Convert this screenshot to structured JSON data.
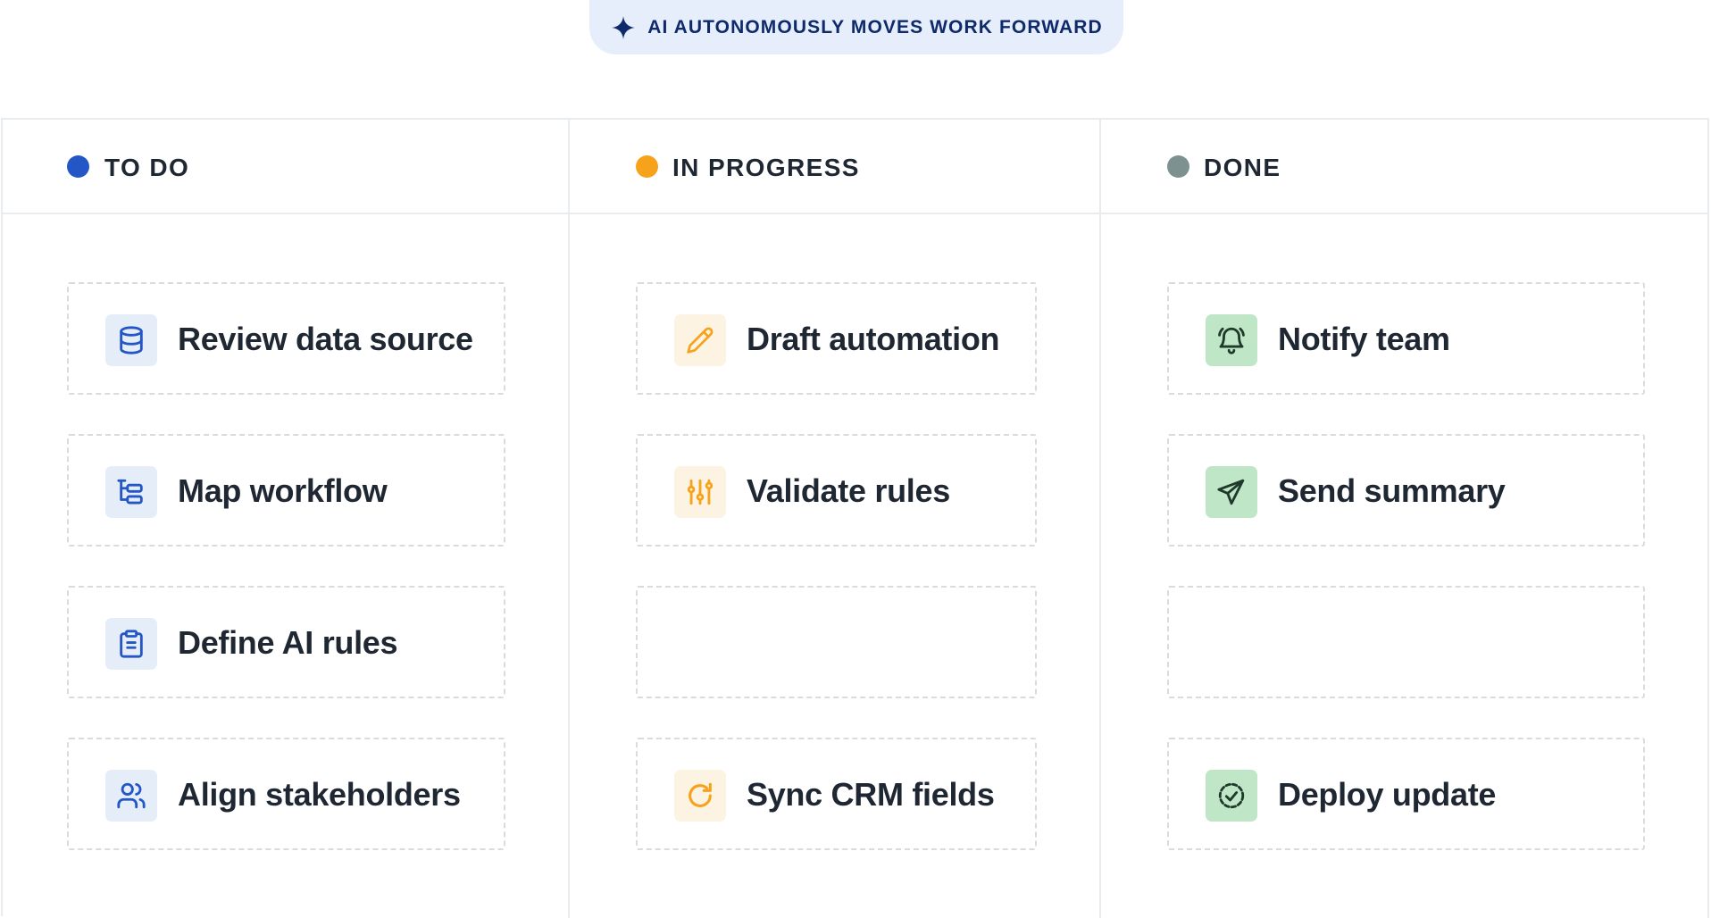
{
  "banner": {
    "text": "AI AUTONOMOUSLY MOVES WORK FORWARD",
    "icon": "sparkle-icon"
  },
  "colors": {
    "todo": "#2457c5",
    "in_progress": "#f7a21b",
    "done": "#7d9190",
    "banner_bg": "#e7eefb",
    "banner_text": "#0e2a6b"
  },
  "columns": [
    {
      "title": "TO DO",
      "cards": [
        {
          "label": "Review data source",
          "icon": "database-icon"
        },
        {
          "label": "Map workflow",
          "icon": "workflow-tree-icon"
        },
        {
          "label": "Define AI rules",
          "icon": "clipboard-icon"
        },
        {
          "label": "Align stakeholders",
          "icon": "users-icon"
        }
      ]
    },
    {
      "title": "IN PROGRESS",
      "cards": [
        {
          "label": "Draft automation",
          "icon": "pencil-icon"
        },
        {
          "label": "Validate rules",
          "icon": "sliders-icon"
        },
        {
          "label": "",
          "icon": ""
        },
        {
          "label": "Sync CRM fields",
          "icon": "refresh-icon"
        }
      ]
    },
    {
      "title": "DONE",
      "cards": [
        {
          "label": "Notify team",
          "icon": "bell-icon"
        },
        {
          "label": "Send summary",
          "icon": "send-icon"
        },
        {
          "label": "",
          "icon": ""
        },
        {
          "label": "Deploy update",
          "icon": "check-circle-icon"
        }
      ]
    }
  ]
}
